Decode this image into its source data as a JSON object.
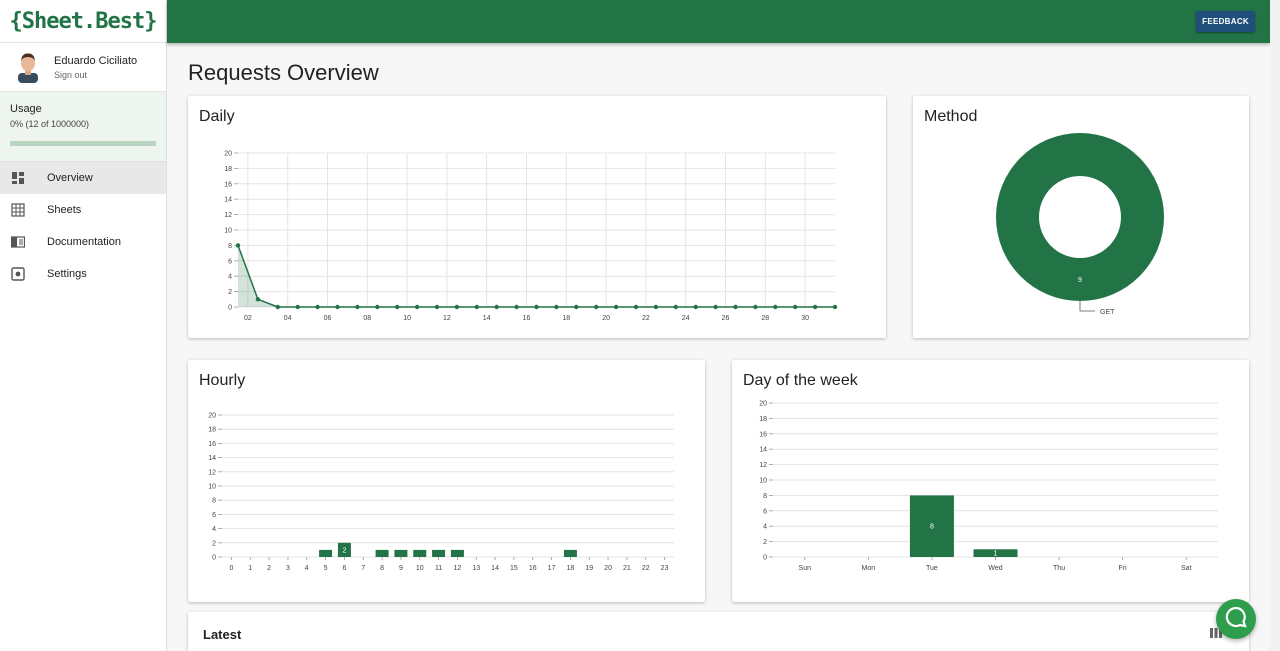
{
  "app": {
    "logo": "{Sheet.Best}",
    "user_name": "Eduardo Ciciliato",
    "signout": "Sign out",
    "feedback": "FEEDBACK"
  },
  "usage": {
    "title": "Usage",
    "text": "0% (12 of 1000000)",
    "fraction": 0.0
  },
  "sidebar": {
    "items": [
      {
        "label": "Overview",
        "icon": "dashboard-icon",
        "active": true
      },
      {
        "label": "Sheets",
        "icon": "grid-icon",
        "active": false
      },
      {
        "label": "Documentation",
        "icon": "book-icon",
        "active": false
      },
      {
        "label": "Settings",
        "icon": "gear-icon",
        "active": false
      }
    ]
  },
  "page": {
    "title": "Requests Overview",
    "latest": "Latest"
  },
  "colors": {
    "brand": "#227447",
    "feedback": "#1f4f7a",
    "chat": "#2e9e4d"
  },
  "chart_data": [
    {
      "type": "line",
      "title": "Daily",
      "x": [
        "01",
        "02",
        "03",
        "04",
        "05",
        "06",
        "07",
        "08",
        "09",
        "10",
        "11",
        "12",
        "13",
        "14",
        "15",
        "16",
        "17",
        "18",
        "19",
        "20",
        "21",
        "22",
        "23",
        "24",
        "25",
        "26",
        "27",
        "28",
        "29",
        "30",
        "31"
      ],
      "x_tick_labels": [
        "02",
        "04",
        "06",
        "08",
        "10",
        "12",
        "14",
        "16",
        "18",
        "20",
        "22",
        "24",
        "26",
        "28",
        "30"
      ],
      "values": [
        8,
        1,
        0,
        0,
        0,
        0,
        0,
        0,
        0,
        0,
        0,
        0,
        0,
        0,
        0,
        0,
        0,
        0,
        0,
        0,
        0,
        0,
        0,
        0,
        0,
        0,
        0,
        0,
        0,
        0,
        0
      ],
      "ylim": [
        0,
        20
      ],
      "y_ticks": [
        0,
        2,
        4,
        6,
        8,
        10,
        12,
        14,
        16,
        18,
        20
      ],
      "grid": true
    },
    {
      "type": "pie",
      "title": "Method",
      "slices": [
        {
          "label": "GET",
          "value": 9
        }
      ],
      "donut": true
    },
    {
      "type": "bar",
      "title": "Hourly",
      "categories": [
        "0",
        "1",
        "2",
        "3",
        "4",
        "5",
        "6",
        "7",
        "8",
        "9",
        "10",
        "11",
        "12",
        "13",
        "14",
        "15",
        "16",
        "17",
        "18",
        "19",
        "20",
        "21",
        "22",
        "23"
      ],
      "values": [
        0,
        0,
        0,
        0,
        0,
        1,
        2,
        0,
        1,
        1,
        1,
        1,
        1,
        0,
        0,
        0,
        0,
        0,
        1,
        0,
        0,
        0,
        0,
        0
      ],
      "labeled_values": {
        "6": "2"
      },
      "ylim": [
        0,
        20
      ],
      "y_ticks": [
        0,
        2,
        4,
        6,
        8,
        10,
        12,
        14,
        16,
        18,
        20
      ],
      "grid": true
    },
    {
      "type": "bar",
      "title": "Day of the week",
      "categories": [
        "Sun",
        "Mon",
        "Tue",
        "Wed",
        "Thu",
        "Fri",
        "Sat"
      ],
      "values": [
        0,
        0,
        8,
        1,
        0,
        0,
        0
      ],
      "labeled_values": {
        "Tue": "8",
        "Wed": "1"
      },
      "ylim": [
        0,
        20
      ],
      "y_ticks": [
        0,
        2,
        4,
        6,
        8,
        10,
        12,
        14,
        16,
        18,
        20
      ],
      "grid": true
    }
  ]
}
